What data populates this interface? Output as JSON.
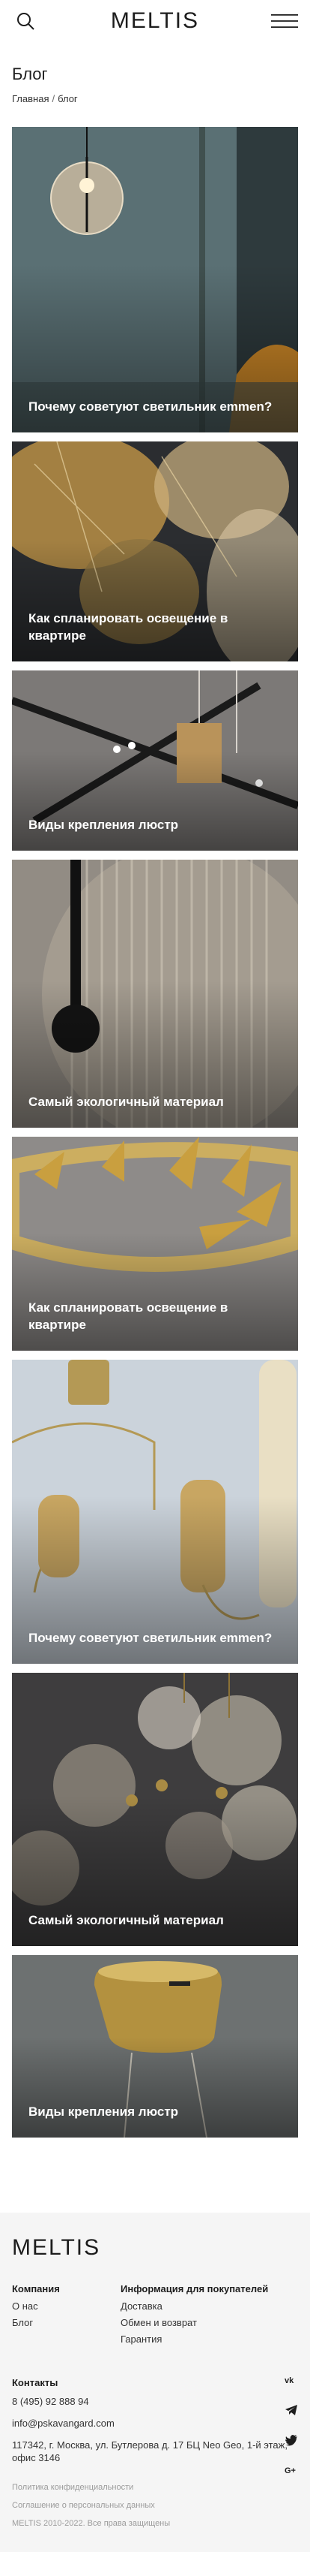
{
  "header": {
    "logo": "MELTIS",
    "search_icon": "search-icon",
    "menu_icon": "hamburger-menu-icon"
  },
  "page": {
    "title": "Блог",
    "breadcrumb": [
      "Главная",
      "/",
      "блог"
    ]
  },
  "cards": [
    {
      "title": "Почему советуют светильник emmen?"
    },
    {
      "title": "Как спланировать освещение в квартире"
    },
    {
      "title": "Виды крепления люстр"
    },
    {
      "title": "Самый экологичный материал"
    },
    {
      "title": "Как спланировать освещение в квартире"
    },
    {
      "title": "Почему советуют светильник emmen?"
    },
    {
      "title": "Самый экологичный материал"
    },
    {
      "title": "Виды крепления люстр"
    }
  ],
  "footer": {
    "logo": "MELTIS",
    "company": {
      "heading": "Компания",
      "links": [
        "О нас",
        "Блог"
      ]
    },
    "buyers": {
      "heading": "Информация для покупателей",
      "links": [
        "Доставка",
        "Обмен и возврат",
        "Гарантия"
      ]
    },
    "contacts": {
      "heading": "Контакты",
      "phone": "8 (495) 92 888 94",
      "email": "info@pskavangard.com",
      "address": "117342, г. Москва, ул. Бутлерова д. 17 БЦ Neo Geo, 1-й этаж, офис 3146"
    },
    "legal": {
      "privacy": "Политика конфиденциальности",
      "consent": "Соглашение о персональных данных",
      "copyright": "MELTIS 2010-2022. Все права защищены"
    },
    "socials": [
      "vk-icon",
      "telegram-icon",
      "twitter-icon",
      "google-plus-icon"
    ]
  }
}
